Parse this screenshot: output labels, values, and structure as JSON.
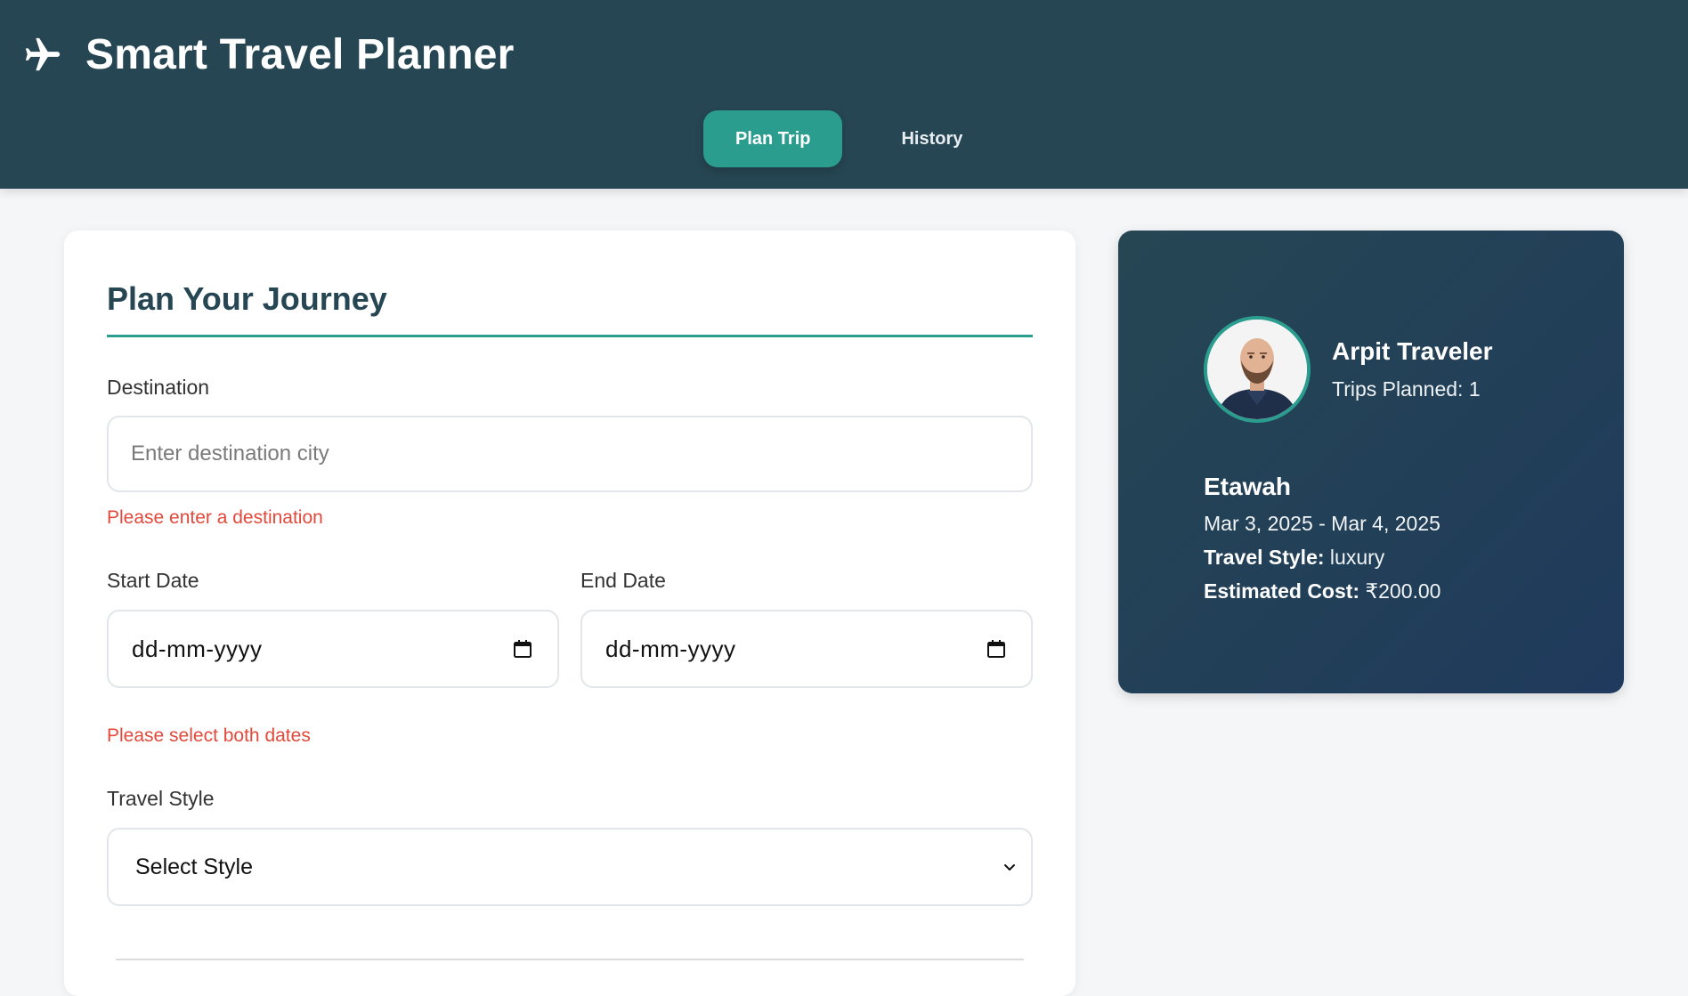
{
  "header": {
    "app_title": "Smart Travel Planner",
    "brand_icon": "airplane-icon",
    "nav": {
      "plan_trip": "Plan Trip",
      "history": "History"
    }
  },
  "form": {
    "title": "Plan Your Journey",
    "destination": {
      "label": "Destination",
      "placeholder": "Enter destination city",
      "value": "",
      "error": "Please enter a destination"
    },
    "start_date": {
      "label": "Start Date",
      "value": "dd-mm-yyyy"
    },
    "end_date": {
      "label": "End Date",
      "value": "dd-mm-yyyy"
    },
    "dates_error": "Please select both dates",
    "travel_style": {
      "label": "Travel Style",
      "selected": "Select Style"
    }
  },
  "profile": {
    "name": "Arpit Traveler",
    "trips_planned": "Trips Planned: 1",
    "last_trip": {
      "destination": "Etawah",
      "dates": "Mar 3, 2025 - Mar 4, 2025",
      "style_label": "Travel Style:",
      "style_value": "luxury",
      "cost_label": "Estimated Cost:",
      "cost_value": "₹200.00"
    }
  },
  "colors": {
    "header_bg": "#264653",
    "accent": "#2a9d8f",
    "error": "#e2493b",
    "profile_gradient_end": "#1f3a5c"
  }
}
